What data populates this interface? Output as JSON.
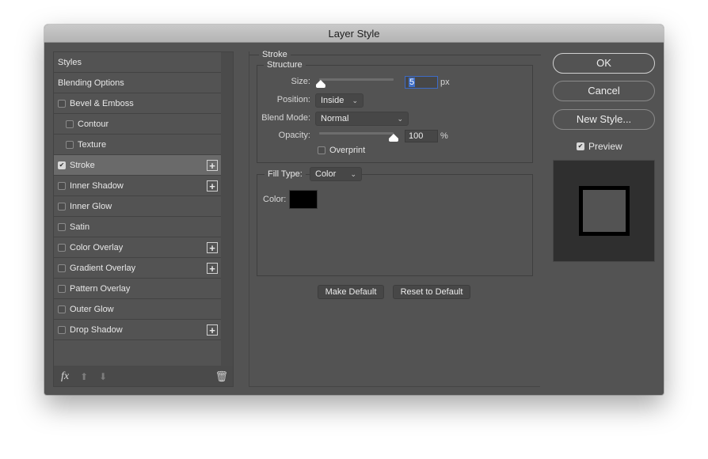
{
  "window": {
    "title": "Layer Style"
  },
  "sidebar": {
    "items": [
      {
        "label": "Styles",
        "checkbox": false,
        "checked": false,
        "plus": false,
        "indent": false,
        "selected": false
      },
      {
        "label": "Blending Options",
        "checkbox": false,
        "checked": false,
        "plus": false,
        "indent": false,
        "selected": false
      },
      {
        "label": "Bevel & Emboss",
        "checkbox": true,
        "checked": false,
        "plus": false,
        "indent": false,
        "selected": false
      },
      {
        "label": "Contour",
        "checkbox": true,
        "checked": false,
        "plus": false,
        "indent": true,
        "selected": false
      },
      {
        "label": "Texture",
        "checkbox": true,
        "checked": false,
        "plus": false,
        "indent": true,
        "selected": false
      },
      {
        "label": "Stroke",
        "checkbox": true,
        "checked": true,
        "plus": true,
        "indent": false,
        "selected": true
      },
      {
        "label": "Inner Shadow",
        "checkbox": true,
        "checked": false,
        "plus": true,
        "indent": false,
        "selected": false
      },
      {
        "label": "Inner Glow",
        "checkbox": true,
        "checked": false,
        "plus": false,
        "indent": false,
        "selected": false
      },
      {
        "label": "Satin",
        "checkbox": true,
        "checked": false,
        "plus": false,
        "indent": false,
        "selected": false
      },
      {
        "label": "Color Overlay",
        "checkbox": true,
        "checked": false,
        "plus": true,
        "indent": false,
        "selected": false
      },
      {
        "label": "Gradient Overlay",
        "checkbox": true,
        "checked": false,
        "plus": true,
        "indent": false,
        "selected": false
      },
      {
        "label": "Pattern Overlay",
        "checkbox": true,
        "checked": false,
        "plus": false,
        "indent": false,
        "selected": false
      },
      {
        "label": "Outer Glow",
        "checkbox": true,
        "checked": false,
        "plus": false,
        "indent": false,
        "selected": false
      },
      {
        "label": "Drop Shadow",
        "checkbox": true,
        "checked": false,
        "plus": true,
        "indent": false,
        "selected": false
      }
    ],
    "footer": {
      "fx_label": "fx",
      "move_up_icon": "arrow-up-icon",
      "move_down_icon": "arrow-down-icon",
      "delete_icon": "trash-icon"
    }
  },
  "stroke": {
    "section_title": "Stroke",
    "structure_title": "Structure",
    "size": {
      "label": "Size:",
      "value": "5",
      "unit": "px",
      "slider_fraction": 0.02
    },
    "position": {
      "label": "Position:",
      "value": "Inside"
    },
    "blend_mode": {
      "label": "Blend Mode:",
      "value": "Normal"
    },
    "opacity": {
      "label": "Opacity:",
      "value": "100",
      "unit": "%",
      "slider_fraction": 1.0
    },
    "overprint": {
      "label": "Overprint",
      "checked": false
    },
    "fill_type": {
      "label": "Fill Type:",
      "value": "Color"
    },
    "color": {
      "label": "Color:",
      "value": "#000000"
    },
    "make_default_label": "Make Default",
    "reset_default_label": "Reset to Default"
  },
  "actions": {
    "ok_label": "OK",
    "cancel_label": "Cancel",
    "new_style_label": "New Style...",
    "preview_label": "Preview",
    "preview_checked": true
  }
}
